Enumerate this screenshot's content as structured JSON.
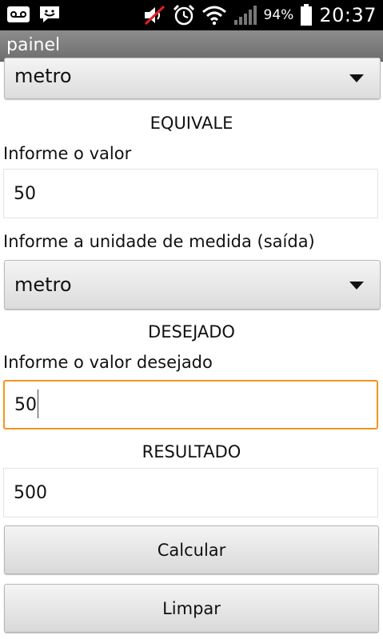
{
  "status_bar": {
    "left_icons": [
      "voicemail-icon",
      "chat-icon"
    ],
    "right_icons": [
      "mute-icon",
      "alarm-icon",
      "wifi-icon",
      "signal-icon"
    ],
    "battery_percent": "94%",
    "time": "20:37"
  },
  "title_bar": {
    "title": "painel"
  },
  "form": {
    "input_unit_value": "metro",
    "equivale_heading": "EQUIVALE",
    "value_label": "Informe o valor",
    "value": "50",
    "output_unit_label": "Informe a unidade de medida (saída)",
    "output_unit_value": "metro",
    "desejado_heading": "DESEJADO",
    "desired_label": "Informe o valor desejado",
    "desired_value": "50",
    "resultado_heading": "RESULTADO",
    "result_value": "500",
    "calcular_label": "Calcular",
    "limpar_label": "Limpar"
  },
  "colors": {
    "status_bar_bg": "#000000",
    "title_bar_bg": "#7d7d7d",
    "focus_border": "#f7931e"
  }
}
